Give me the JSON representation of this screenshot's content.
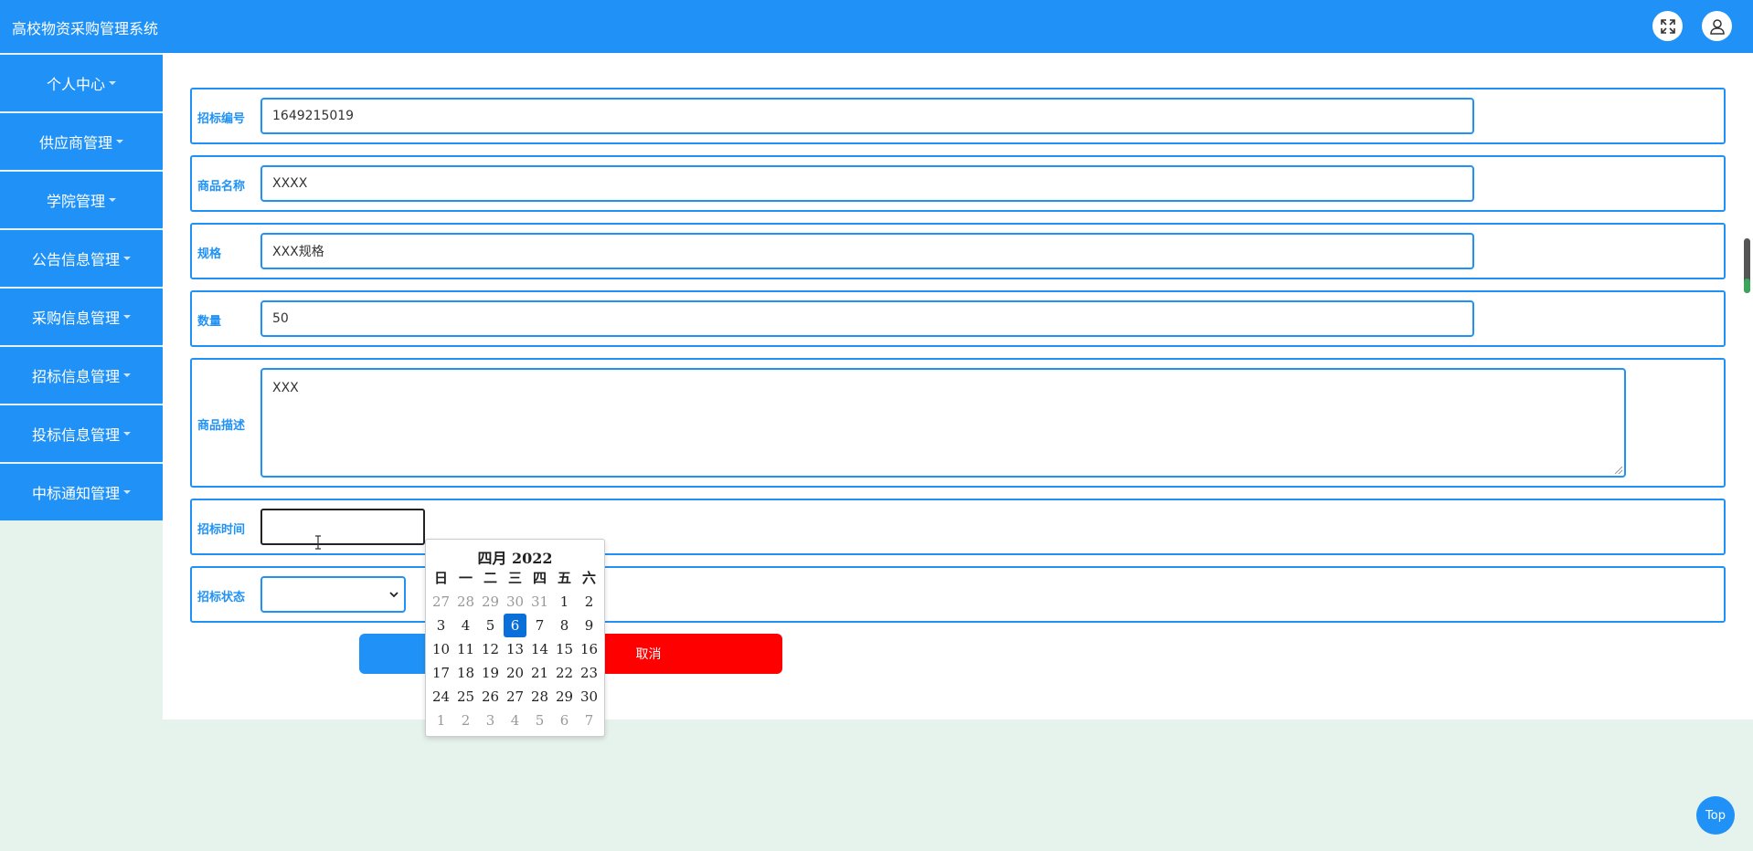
{
  "header": {
    "title": "高校物资采购管理系统"
  },
  "sidebar": {
    "items": [
      {
        "label": "个人中心"
      },
      {
        "label": "供应商管理"
      },
      {
        "label": "学院管理"
      },
      {
        "label": "公告信息管理"
      },
      {
        "label": "采购信息管理"
      },
      {
        "label": "招标信息管理"
      },
      {
        "label": "投标信息管理"
      },
      {
        "label": "中标通知管理"
      }
    ]
  },
  "form": {
    "bid_number": {
      "label": "招标编号",
      "value": "1649215019"
    },
    "product_name": {
      "label": "商品名称",
      "value": "XXXX"
    },
    "spec": {
      "label": "规格",
      "value": "XXX规格"
    },
    "quantity": {
      "label": "数量",
      "value": "50"
    },
    "description": {
      "label": "商品描述",
      "value": "XXX"
    },
    "bid_time": {
      "label": "招标时间",
      "value": ""
    },
    "bid_status": {
      "label": "招标状态",
      "value": ""
    },
    "cancel_label": "取消"
  },
  "datepicker": {
    "month_label": "四月 2022",
    "weekdays": [
      "日",
      "一",
      "二",
      "三",
      "四",
      "五",
      "六"
    ],
    "weeks": [
      [
        "27",
        "28",
        "29",
        "30",
        "31",
        "1",
        "2"
      ],
      [
        "3",
        "4",
        "5",
        "6",
        "7",
        "8",
        "9"
      ],
      [
        "10",
        "11",
        "12",
        "13",
        "14",
        "15",
        "16"
      ],
      [
        "17",
        "18",
        "19",
        "20",
        "21",
        "22",
        "23"
      ],
      [
        "24",
        "25",
        "26",
        "27",
        "28",
        "29",
        "30"
      ],
      [
        "1",
        "2",
        "3",
        "4",
        "5",
        "6",
        "7"
      ]
    ],
    "selected_day": "6"
  },
  "top_button": "Top",
  "colors": {
    "primary": "#2092f7",
    "danger": "#ff0000",
    "page_bg": "#e6f2ec",
    "selected_day": "#0a6fd8"
  }
}
